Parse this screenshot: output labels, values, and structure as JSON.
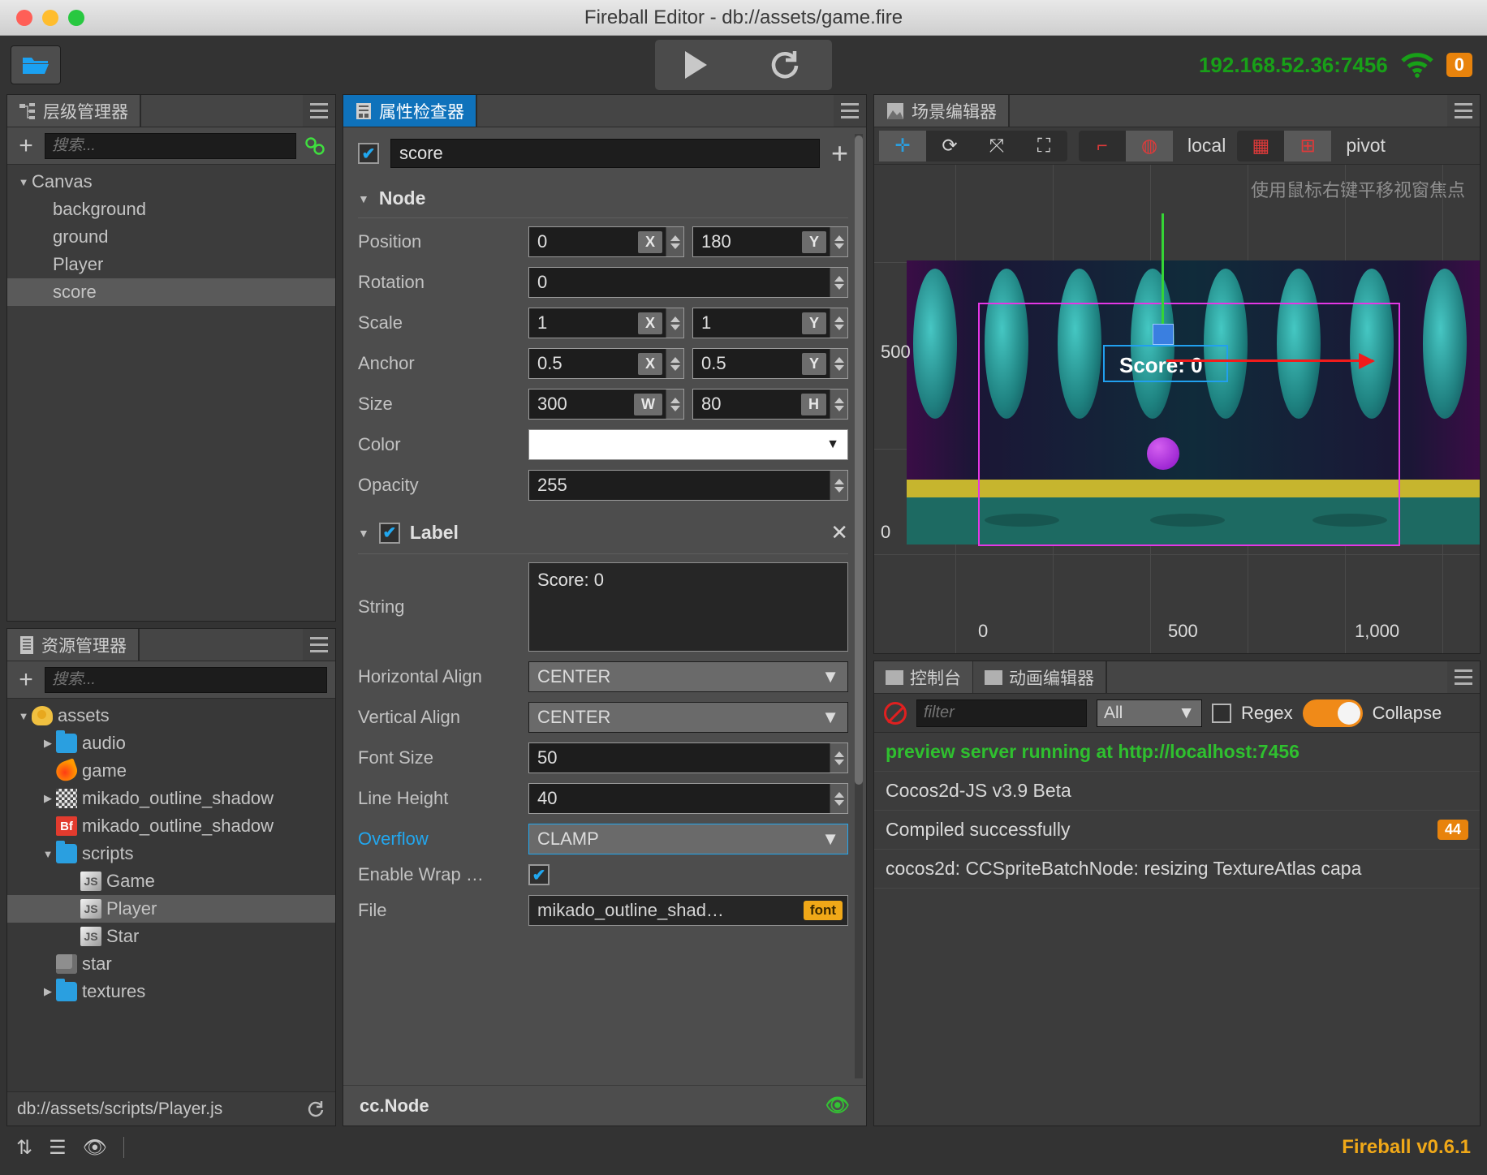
{
  "window": {
    "title": "Fireball Editor - db://assets/game.fire"
  },
  "toolbar": {
    "open_icon": "folder-open-icon",
    "play_icon": "play-icon",
    "refresh_icon": "refresh-icon",
    "ip_address": "192.168.52.36:7456",
    "wifi_icon": "wifi-icon",
    "client_count": "0"
  },
  "hierarchy": {
    "tab_label": "层级管理器",
    "tab_icon": "hierarchy-icon",
    "add_label": "+",
    "search_placeholder": "搜索...",
    "link_icon": "link-icon",
    "menu_icon": "hamburger-icon",
    "nodes": [
      {
        "label": "Canvas",
        "depth": 0,
        "expanded": true,
        "selected": false
      },
      {
        "label": "background",
        "depth": 1,
        "expanded": null,
        "selected": false
      },
      {
        "label": "ground",
        "depth": 1,
        "expanded": null,
        "selected": false
      },
      {
        "label": "Player",
        "depth": 1,
        "expanded": null,
        "selected": false
      },
      {
        "label": "score",
        "depth": 1,
        "expanded": null,
        "selected": true
      }
    ]
  },
  "assets": {
    "tab_label": "资源管理器",
    "tab_icon": "assets-icon",
    "add_label": "+",
    "search_placeholder": "搜索...",
    "menu_icon": "hamburger-icon",
    "nodes": [
      {
        "label": "assets",
        "depth": 0,
        "icon": "assets-root-icon",
        "expanded": true,
        "selected": false
      },
      {
        "label": "audio",
        "depth": 1,
        "icon": "folder-icon",
        "expanded": false,
        "selected": false
      },
      {
        "label": "game",
        "depth": 1,
        "icon": "fire-scene-icon",
        "expanded": null,
        "selected": false
      },
      {
        "label": "mikado_outline_shadow",
        "depth": 1,
        "icon": "texture-icon",
        "expanded": false,
        "selected": false
      },
      {
        "label": "mikado_outline_shadow",
        "depth": 1,
        "icon": "bitmap-font-icon",
        "expanded": null,
        "selected": false
      },
      {
        "label": "scripts",
        "depth": 1,
        "icon": "folder-icon",
        "expanded": true,
        "selected": false
      },
      {
        "label": "Game",
        "depth": 2,
        "icon": "js-icon",
        "expanded": null,
        "selected": false
      },
      {
        "label": "Player",
        "depth": 2,
        "icon": "js-icon",
        "expanded": null,
        "selected": true
      },
      {
        "label": "Star",
        "depth": 2,
        "icon": "js-icon",
        "expanded": null,
        "selected": false
      },
      {
        "label": "star",
        "depth": 1,
        "icon": "prefab-icon",
        "expanded": null,
        "selected": false
      },
      {
        "label": "textures",
        "depth": 1,
        "icon": "folder-icon",
        "expanded": false,
        "selected": false
      }
    ],
    "status_path": "db://assets/scripts/Player.js",
    "status_refresh_icon": "refresh-icon"
  },
  "inspector": {
    "tab_label": "属性检查器",
    "tab_icon": "inspector-icon",
    "menu_icon": "hamburger-icon",
    "node_enabled": true,
    "node_name": "score",
    "add_component_label": "+",
    "node_section": {
      "title": "Node",
      "position": {
        "label": "Position",
        "x": "0",
        "y": "180",
        "x_axis": "X",
        "y_axis": "Y"
      },
      "rotation": {
        "label": "Rotation",
        "value": "0"
      },
      "scale": {
        "label": "Scale",
        "x": "1",
        "y": "1",
        "x_axis": "X",
        "y_axis": "Y"
      },
      "anchor": {
        "label": "Anchor",
        "x": "0.5",
        "y": "0.5",
        "x_axis": "X",
        "y_axis": "Y"
      },
      "size": {
        "label": "Size",
        "w": "300",
        "h": "80",
        "w_axis": "W",
        "h_axis": "H"
      },
      "color": {
        "label": "Color",
        "value": "#ffffff"
      },
      "opacity": {
        "label": "Opacity",
        "value": "255"
      }
    },
    "label_section": {
      "title": "Label",
      "enabled": true,
      "close_icon": "close-icon",
      "string": {
        "label": "String",
        "value": "Score: 0"
      },
      "horizontal_align": {
        "label": "Horizontal Align",
        "value": "CENTER"
      },
      "vertical_align": {
        "label": "Vertical Align",
        "value": "CENTER"
      },
      "font_size": {
        "label": "Font Size",
        "value": "50"
      },
      "line_height": {
        "label": "Line Height",
        "value": "40"
      },
      "overflow": {
        "label": "Overflow",
        "value": "CLAMP",
        "highlighted": true
      },
      "enable_wrap": {
        "label": "Enable Wrap …",
        "checked": true
      },
      "file": {
        "label": "File",
        "value": "mikado_outline_shad…",
        "badge": "font"
      }
    },
    "footer_type": "cc.Node",
    "footer_eye_icon": "eye-icon"
  },
  "scene": {
    "tab_label": "场景编辑器",
    "tab_icon": "scene-icon",
    "menu_icon": "hamburger-icon",
    "tools": [
      {
        "name": "move-tool",
        "glyph": "✛",
        "active": true
      },
      {
        "name": "rotate-tool",
        "glyph": "⟳",
        "active": false
      },
      {
        "name": "scale-tool",
        "glyph": "⤧",
        "active": false
      },
      {
        "name": "rect-tool",
        "glyph": "⛶",
        "active": false
      }
    ],
    "coord_buttons": [
      {
        "name": "local-space-toggle",
        "glyph": "⌐",
        "active": false
      },
      {
        "name": "global-space-toggle",
        "glyph": "◍",
        "active": true
      }
    ],
    "coord_label": "local",
    "pivot_buttons": [
      {
        "name": "pivot-center-toggle",
        "glyph": "▦",
        "active": false
      },
      {
        "name": "pivot-point-toggle",
        "glyph": "⊞",
        "active": true
      }
    ],
    "pivot_label": "pivot",
    "hint_text": "使用鼠标右键平移视窗焦点",
    "score_text": "Score: 0",
    "axis_labels": {
      "y_top": "500",
      "y_bottom": "0",
      "x": [
        "0",
        "500",
        "1,000"
      ]
    }
  },
  "console": {
    "tabs": [
      {
        "label": "控制台",
        "icon": "console-icon",
        "active": true
      },
      {
        "label": "动画编辑器",
        "icon": "animation-icon",
        "active": false
      }
    ],
    "menu_icon": "hamburger-icon",
    "clear_icon": "clear-icon",
    "filter_placeholder": "filter",
    "level_value": "All",
    "regex_label": "Regex",
    "regex_checked": false,
    "collapse_label": "Collapse",
    "collapse_on": true,
    "logs": [
      {
        "text": "preview server running at http://localhost:7456",
        "style": "green",
        "count": ""
      },
      {
        "text": "Cocos2d-JS v3.9 Beta",
        "style": "normal",
        "count": ""
      },
      {
        "text": "Compiled successfully",
        "style": "normal",
        "count": "44"
      },
      {
        "text": "cocos2d: CCSpriteBatchNode: resizing TextureAtlas capa",
        "style": "normal",
        "count": ""
      }
    ]
  },
  "statusbar": {
    "icons": [
      "sync-icon",
      "layers-icon",
      "eye-off-icon"
    ],
    "version": "Fireball v0.6.1"
  }
}
